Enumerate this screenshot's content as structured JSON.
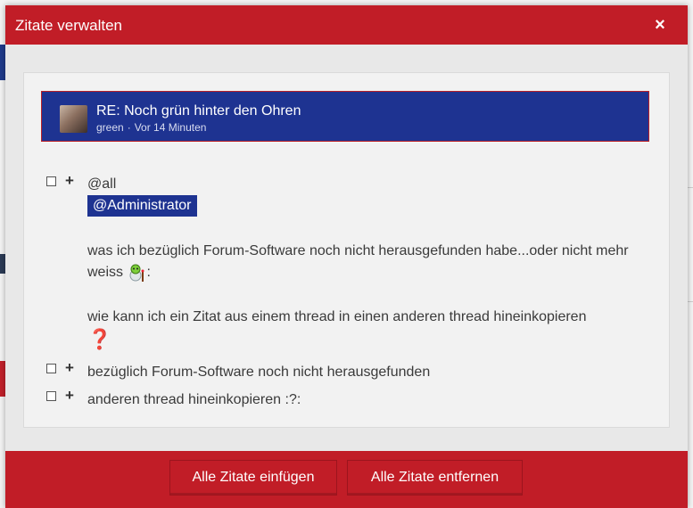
{
  "dialog": {
    "title": "Zitate verwalten",
    "close_symbol": "×"
  },
  "post": {
    "title": "RE: Noch grün hinter den Ohren",
    "author": "green",
    "separator": "·",
    "time": "Vor 14 Minuten"
  },
  "quotes": [
    {
      "line1": "@all",
      "mention": "@Administrator",
      "para1": "was ich bezüglich Forum-Software noch nicht herausgefunden habe...oder nicht mehr weiss",
      "para1_suffix": ":",
      "para2": "wie kann ich ein Zitat aus einem thread in einen anderen thread hineinkopieren",
      "qmark": "❓"
    },
    {
      "text": "bezüglich Forum-Software noch nicht herausgefunden"
    },
    {
      "text": "anderen thread hineinkopieren :?:"
    }
  ],
  "footer": {
    "insert_all": "Alle Zitate einfügen",
    "remove_all": "Alle Zitate entfernen"
  },
  "colors": {
    "header_red": "#c11d27",
    "post_blue": "#1e3391"
  },
  "icons": [
    "close-icon",
    "plus-icon",
    "checkbox-icon",
    "confused-smiley-icon",
    "question-mark-icon"
  ]
}
